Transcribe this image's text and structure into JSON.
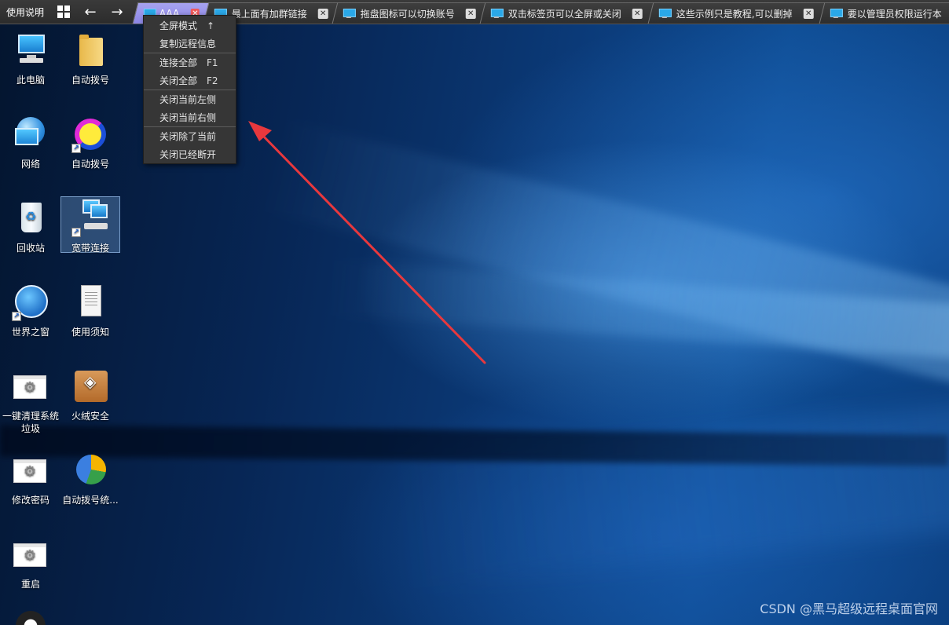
{
  "toolbar": {
    "help_label": "使用说明",
    "back_label": "←",
    "forward_label": "→"
  },
  "tabs": [
    {
      "label": "AAA",
      "active": true
    },
    {
      "label": "最上面有加群链接",
      "active": false
    },
    {
      "label": "拖盘图标可以切换账号",
      "active": false
    },
    {
      "label": "双击标签页可以全屏或关闭",
      "active": false
    },
    {
      "label": "这些示例只是教程,可以删掉",
      "active": false
    },
    {
      "label": "要以管理员权限运行本",
      "active": false
    }
  ],
  "context_menu": {
    "items": [
      {
        "label": "全屏模式",
        "shortcut": "↑"
      },
      {
        "label": "复制远程信息",
        "shortcut": ""
      },
      {
        "label": "连接全部",
        "shortcut": "F1"
      },
      {
        "label": "关闭全部",
        "shortcut": "F2"
      },
      {
        "label": "关闭当前左侧",
        "shortcut": ""
      },
      {
        "label": "关闭当前右侧",
        "shortcut": ""
      },
      {
        "label": "关闭除了当前",
        "shortcut": ""
      },
      {
        "label": "关闭已经断开",
        "shortcut": ""
      }
    ]
  },
  "desktop_icons": [
    {
      "label": "此电脑",
      "icon": "computer-icon"
    },
    {
      "label": "自动拨号",
      "icon": "folder-icon"
    },
    {
      "label": "网络",
      "icon": "network-icon"
    },
    {
      "label": "自动拨号",
      "icon": "sync-icon"
    },
    {
      "label": "回收站",
      "icon": "recycle-bin-icon"
    },
    {
      "label": "宽带连接",
      "icon": "broadband-icon",
      "selected": true
    },
    {
      "label": "世界之窗",
      "icon": "browser-globe-icon"
    },
    {
      "label": "使用须知",
      "icon": "text-document-icon"
    },
    {
      "label": "一键清理系统垃圾",
      "icon": "settings-window-icon"
    },
    {
      "label": "火绒安全",
      "icon": "security-shield-icon"
    },
    {
      "label": "修改密码",
      "icon": "settings-window-icon"
    },
    {
      "label": "自动拨号统...",
      "icon": "pie-chart-icon"
    },
    {
      "label": "重启",
      "icon": "settings-window-icon"
    }
  ],
  "watermark": "CSDN @黑马超级远程桌面官网",
  "colors": {
    "accent_tab": "#9b96ec",
    "arrow": "#e8383d",
    "menu_bg": "#363636"
  }
}
